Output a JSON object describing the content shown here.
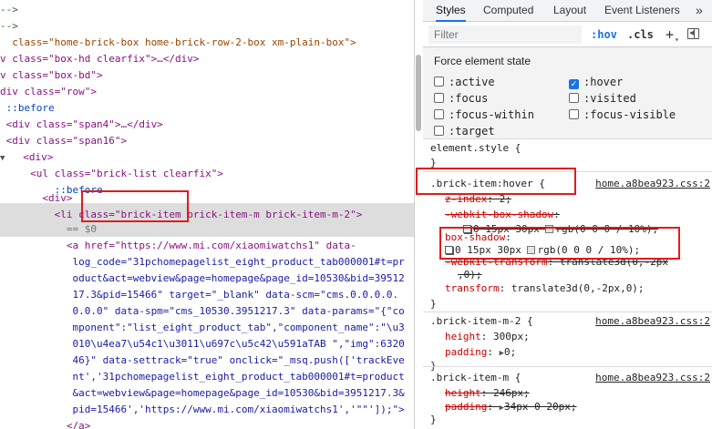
{
  "elements_panel": {
    "lines": [
      {
        "indent": 0,
        "text": "-->"
      },
      {
        "indent": 0,
        "text": "-->"
      },
      {
        "indent": 0,
        "text": "  class=\"home-brick-box home-brick-row-2-box xm-plain-box\">"
      },
      {
        "indent": 0,
        "text": "v class=\"box-hd clearfix\">…</div>"
      },
      {
        "indent": 0,
        "text": "v class=\"box-bd\">"
      },
      {
        "indent": 0,
        "text": "div class=\"row\">"
      },
      {
        "indent": 0,
        "text": " ::before"
      },
      {
        "indent": 0,
        "text": " <div class=\"span4\">…</div>"
      },
      {
        "indent": 0,
        "text": " <div class=\"span16\">"
      },
      {
        "indent": 0,
        "text": "   <div>"
      },
      {
        "indent": 0,
        "text": "     <ul class=\"brick-list clearfix\">"
      },
      {
        "indent": 0,
        "text": "         ::before"
      },
      {
        "indent": 0,
        "text": "       <div>"
      },
      {
        "indent": 0,
        "text": "         <li class=\"brick-item brick-item-m brick-item-m-2\">"
      },
      {
        "indent": 0,
        "text": "           == $0"
      },
      {
        "indent": 0,
        "text": "           <a href=\"https://www.mi.com/xiaomiwatchs1\" data-"
      },
      {
        "indent": 0,
        "text": "            log_code=\"31pchomepagelist_eight_product_tab000001#t=pr"
      },
      {
        "indent": 0,
        "text": "            oduct&act=webview&page=homepage&page_id=10530&bid=39512"
      },
      {
        "indent": 0,
        "text": "            17.3&pid=15466\" target=\"_blank\" data-scm=\"cms.0.0.0.0."
      },
      {
        "indent": 0,
        "text": "            0.0.0\" data-spm=\"cms_10530.3951217.3\" data-params=\"{\"co"
      },
      {
        "indent": 0,
        "text": "            mponent\":\"list_eight_product_tab\",\"component_name\":\"\\u3"
      },
      {
        "indent": 0,
        "text": "            010\\u4ea7\\u54c1\\u3011\\u697c\\u5c42\\u591aTAB \",\"img\":6320"
      },
      {
        "indent": 0,
        "text": "            46}\" data-settrack=\"true\" onclick=\"_msq.push(['trackEve"
      },
      {
        "indent": 0,
        "text": "            nt','31pchomepagelist_eight_product_tab000001#t=product"
      },
      {
        "indent": 0,
        "text": "            &act=webview&page=homepage&page_id=10530&bid=3951217.3&"
      },
      {
        "indent": 0,
        "text": "            pid=15466','https://www.mi.com/xiaomiwatchs1','\"\"']);\">"
      },
      {
        "indent": 0,
        "text": "           </a>"
      },
      {
        "indent": 0,
        "text": "         </li>"
      }
    ]
  },
  "styles_panel": {
    "tabs": [
      "Styles",
      "Computed",
      "Layout",
      "Event Listeners",
      "»"
    ],
    "filter_placeholder": "Filter",
    "hov_label": ":hov",
    "cls_label": ".cls",
    "plus_label": "+",
    "force_state_title": "Force element state",
    "states_left": [
      ":active",
      ":focus",
      ":focus-within",
      ":target"
    ],
    "states_right": [
      ":hover",
      ":visited",
      ":focus-visible"
    ],
    "checked_state": ":hover",
    "element_style": {
      "selector": "element.style {",
      "close": "}"
    },
    "rules": [
      {
        "selector": ".brick-item:hover {",
        "source": "home.a8bea923.css:2",
        "decls": [
          {
            "prop": "z-index",
            "val": "2;",
            "struck": false
          },
          {
            "prop": "-webkit-box-shadow",
            "val": "",
            "struck": true
          },
          {
            "prop": "",
            "val": "0 15px 30px rgb(0 0 0 / 10%);",
            "struck": true,
            "cont": true
          },
          {
            "prop": "box-shadow",
            "val": "",
            "struck": false
          },
          {
            "prop": "",
            "val": "0 15px 30px rgb(0 0 0 / 10%);",
            "struck": false,
            "cont": true
          },
          {
            "prop": "-webkit-transform",
            "val": "translate3d(0,-2px",
            "struck": true
          },
          {
            "prop": "",
            "val": ",0);",
            "struck": true,
            "cont": true
          },
          {
            "prop": "transform",
            "val": "translate3d(0,-2px,0);",
            "struck": false
          }
        ]
      },
      {
        "selector": ".brick-item-m-2 {",
        "source": "home.a8bea923.css:2",
        "decls": [
          {
            "prop": "height",
            "val": "300px;",
            "struck": false
          },
          {
            "prop": "padding",
            "val": "0;",
            "struck": false
          }
        ]
      },
      {
        "selector": ".brick-item-m {",
        "source": "home.a8bea923.css:2",
        "decls": [
          {
            "prop": "height",
            "val": "246px;",
            "struck": true
          },
          {
            "prop": "padding",
            "val": "34px 0 20px;",
            "struck": true
          }
        ]
      }
    ]
  }
}
